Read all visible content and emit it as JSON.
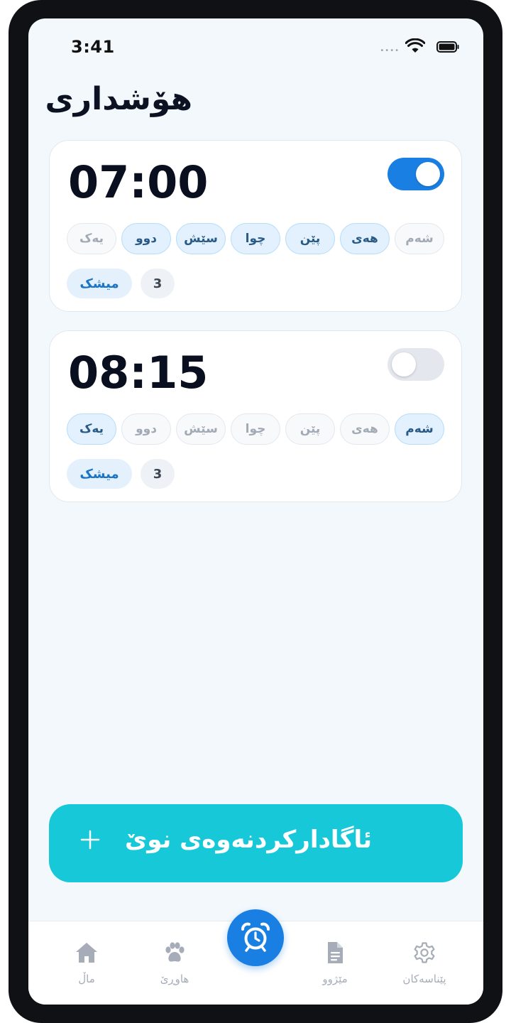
{
  "status_bar": {
    "time": "3:41",
    "signal": "••••"
  },
  "page": {
    "title": "هۆشداری"
  },
  "alarms": [
    {
      "time": "07:00",
      "enabled": true,
      "days": [
        {
          "label": "شەم",
          "active": false
        },
        {
          "label": "هەی",
          "active": true
        },
        {
          "label": "پێن",
          "active": true
        },
        {
          "label": "چوا",
          "active": true
        },
        {
          "label": "سێش",
          "active": true
        },
        {
          "label": "دوو",
          "active": true
        },
        {
          "label": "یەک",
          "active": false
        }
      ],
      "sound": "میشک",
      "snooze": "3"
    },
    {
      "time": "08:15",
      "enabled": false,
      "days": [
        {
          "label": "شەم",
          "active": true
        },
        {
          "label": "هەی",
          "active": false
        },
        {
          "label": "پێن",
          "active": false
        },
        {
          "label": "چوا",
          "active": false
        },
        {
          "label": "سێش",
          "active": false
        },
        {
          "label": "دوو",
          "active": false
        },
        {
          "label": "یەک",
          "active": true
        }
      ],
      "sound": "میشک",
      "snooze": "3"
    }
  ],
  "add_button": {
    "label": "ئاگادارکردنەوەی نوێ",
    "icon": "plus-icon"
  },
  "tab_bar": {
    "tabs": [
      {
        "label": "ماڵ",
        "icon": "home-icon"
      },
      {
        "label": "هاوڕێ",
        "icon": "paw-icon"
      },
      {
        "label": "",
        "icon": "alarm-clock-icon"
      },
      {
        "label": "مێژوو",
        "icon": "document-icon"
      },
      {
        "label": "پێناسەکان",
        "icon": "gear-icon"
      }
    ]
  },
  "colors": {
    "accent": "#1a7fe3",
    "add_button": "#16c8d8",
    "background": "#f3f8fd"
  }
}
